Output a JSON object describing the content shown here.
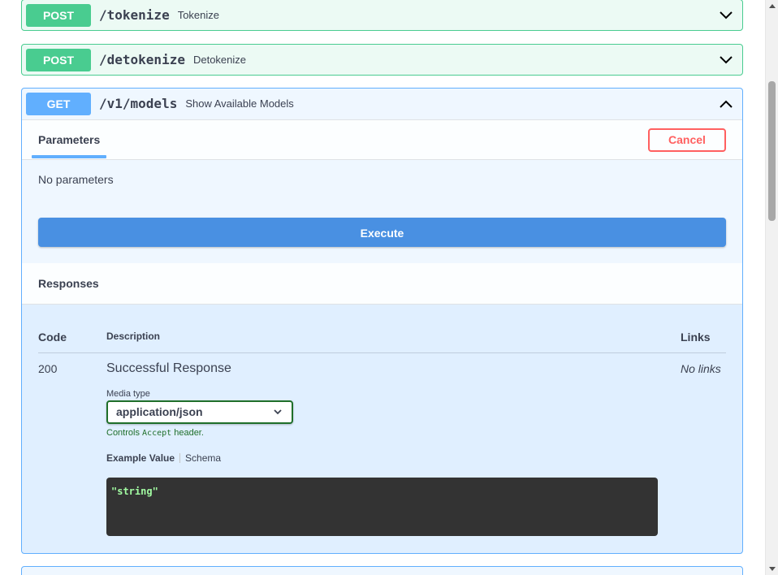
{
  "endpoints": [
    {
      "method": "POST",
      "path": "/tokenize",
      "summary": "Tokenize"
    },
    {
      "method": "POST",
      "path": "/detokenize",
      "summary": "Detokenize"
    },
    {
      "method": "GET",
      "path": "/v1/models",
      "summary": "Show Available Models"
    }
  ],
  "expanded": {
    "parameters_tab": "Parameters",
    "cancel_label": "Cancel",
    "no_parameters": "No parameters",
    "execute_label": "Execute",
    "responses_title": "Responses",
    "table_headers": {
      "code": "Code",
      "description": "Description",
      "links": "Links"
    },
    "response": {
      "code": "200",
      "description": "Successful Response",
      "links": "No links",
      "media_type_label": "Media type",
      "media_type_value": "application/json",
      "controls_prefix": "Controls",
      "controls_code": "Accept",
      "controls_suffix": "header.",
      "example_tab": "Example Value",
      "schema_tab": "Schema",
      "example_code": "\"string\""
    }
  },
  "colors": {
    "post": "#49cc90",
    "get": "#61affe",
    "execute": "#4990e2",
    "cancel": "#ff6060"
  },
  "icons": {
    "collapse": "chevron-down-icon",
    "expand": "chevron-up-icon",
    "select": "chevron-down-icon"
  }
}
